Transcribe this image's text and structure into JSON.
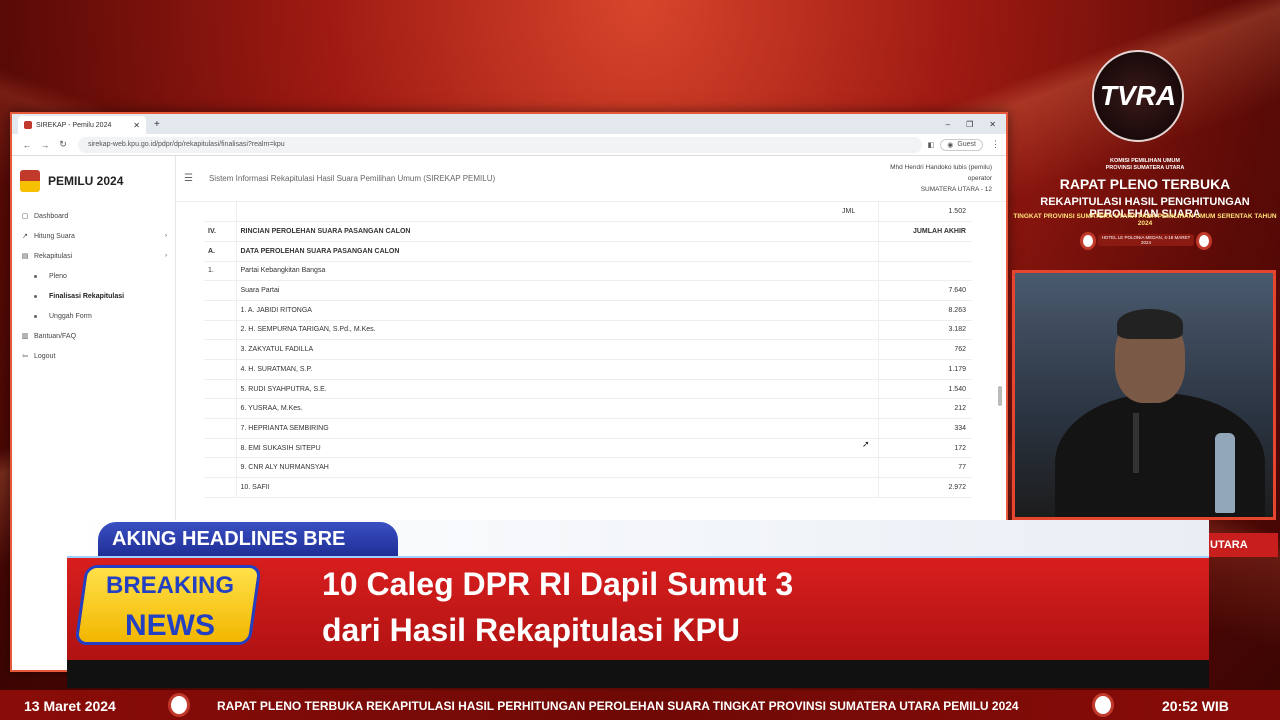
{
  "browser": {
    "tab_title": "SIREKAP - Pemilu 2024",
    "new_tab": "+",
    "url": "sirekap-web.kpu.go.id/pdpr/dp/rekapitulasi/finalisasi?realm=kpu",
    "guest_label": "Guest"
  },
  "app": {
    "brand": "PEMILU 2024",
    "system_title": "Sistem Informasi Rekapitulasi Hasil Suara Pemilihan Umum (SIREKAP PEMILU)",
    "user": {
      "name": "Mhd Hendri Handoko lubis (pemilu)",
      "role": "operator",
      "region": "SUMATERA UTARA - 12"
    }
  },
  "sidebar": {
    "items": [
      {
        "label": "Dashboard",
        "icon": "dashboard-icon",
        "glyph": "▢"
      },
      {
        "label": "Hitung Suara",
        "icon": "chart-icon",
        "glyph": "↗",
        "caret": "›"
      },
      {
        "label": "Rekapitulasi",
        "icon": "document-icon",
        "glyph": "▤",
        "caret": "›"
      },
      {
        "label": "Pleno",
        "sub": true
      },
      {
        "label": "Finalisasi Rekapitulasi",
        "sub": true,
        "active": true
      },
      {
        "label": "Unggah Form",
        "sub": true
      },
      {
        "label": "Bantuan/FAQ",
        "icon": "book-icon",
        "glyph": "▥"
      },
      {
        "label": "Logout",
        "icon": "logout-icon",
        "glyph": "⇦"
      }
    ]
  },
  "table": {
    "rows": [
      {
        "no": "",
        "name": "",
        "mid": "JML",
        "value": "1.502"
      },
      {
        "no": "IV.",
        "name": "RINCIAN PEROLEHAN SUARA PASANGAN CALON",
        "mid": "",
        "value": "JUMLAH AKHIR",
        "bold": true
      },
      {
        "no": "A.",
        "name": "DATA PEROLEHAN SUARA PASANGAN CALON",
        "mid": "",
        "value": "",
        "bold": true
      },
      {
        "no": "1.",
        "name": "Partai Kebangkitan Bangsa",
        "mid": "",
        "value": ""
      },
      {
        "no": "",
        "name": "Suara Partai",
        "mid": "",
        "value": "7.640"
      },
      {
        "no": "",
        "name": "1. A. JABIDI RITONGA",
        "mid": "",
        "value": "8.263"
      },
      {
        "no": "",
        "name": "2. H. SEMPURNA TARIGAN, S.Pd., M.Kes.",
        "mid": "",
        "value": "3.182"
      },
      {
        "no": "",
        "name": "3. ZAKYATUL FADILLA",
        "mid": "",
        "value": "762"
      },
      {
        "no": "",
        "name": "4. H. SURATMAN, S.P.",
        "mid": "",
        "value": "1.179"
      },
      {
        "no": "",
        "name": "5. RUDI SYAHPUTRA, S.E.",
        "mid": "",
        "value": "1.540"
      },
      {
        "no": "",
        "name": "6. YUSRAA, M.Kes.",
        "mid": "",
        "value": "212"
      },
      {
        "no": "",
        "name": "7. HEPRIANTA SEMBIRING",
        "mid": "",
        "value": "334"
      },
      {
        "no": "",
        "name": "8. EMI SUKASIH SITEPU",
        "mid": "",
        "value": "172"
      },
      {
        "no": "",
        "name": "9. CNR ALY NURMANSYAH",
        "mid": "",
        "value": "77"
      },
      {
        "no": "",
        "name": "10. SAFII",
        "mid": "",
        "value": "2.972"
      }
    ]
  },
  "overlay": {
    "channel_logo": "TVRA",
    "kpu_label_1": "KOMISI PEMILIHAN UMUM",
    "kpu_label_2": "PROVINSI SUMATERA UTARA",
    "title": "RAPAT PLENO TERBUKA",
    "subtitle": "REKAPITULASI HASIL PENGHITUNGAN PEROLEHAN SUARA",
    "subtitle2": "TINGKAT PROVINSI SUMATERA UTARA PADA PEMILIHAN UMUM SERENTAK TAHUN 2024",
    "location": "HOTEL LE POLONIA MEDAN, 4-18 MARET 2024",
    "utara_tag": "UTARA",
    "headlines_tab": "AKING HEADLINES    BRE",
    "badge_top": "BREAKING",
    "badge_bottom": "NEWS",
    "headline_1": "10 Caleg DPR RI Dapil Sumut 3",
    "headline_2": "dari Hasil Rekapitulasi KPU"
  },
  "ticker": {
    "date": "13 Maret 2024",
    "text": "RAPAT PLENO TERBUKA REKAPITULASI HASIL PERHITUNGAN PEROLEHAN SUARA TINGKAT PROVINSI SUMATERA UTARA PEMILU 2024",
    "time": "20:52 WIB"
  },
  "colors": {
    "accent_red": "#c81e1e",
    "news_yellow": "#f2b600",
    "news_blue": "#2340c2"
  }
}
